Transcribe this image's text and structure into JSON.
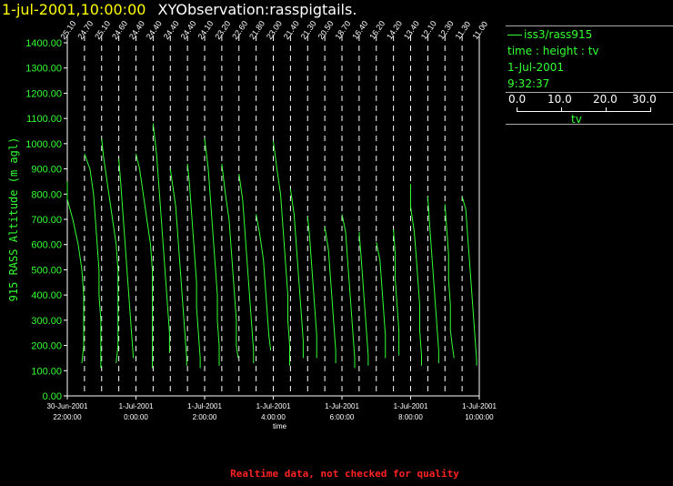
{
  "header": {
    "time_label": "1-jul-2001,10:00:00",
    "observation_label": "XYObservation:rasspigtails."
  },
  "legend": {
    "series_label": "iss3/rass915",
    "axes_desc": "time : height : tv",
    "date": "1-Jul-2001",
    "time": "9:32:37",
    "colorbar_ticks": [
      "0.0",
      "10.0",
      "20.0",
      "30.0"
    ],
    "colorbar_label": "tv"
  },
  "footer": {
    "notice": "Realtime data, not checked for quality"
  },
  "colors": {
    "trace": "#33ff33",
    "axis": "#ffffff",
    "title_time": "#ffff00",
    "notice": "#ff2222"
  },
  "chart_data": {
    "type": "line",
    "ylabel": "915 RASS Altitude (m agl)",
    "xlabel": "time",
    "ylim": [
      0,
      1400
    ],
    "yticks": [
      "0.00",
      "100.00",
      "200.00",
      "300.00",
      "400.00",
      "500.00",
      "600.00",
      "700.00",
      "800.00",
      "900.00",
      "1000.00",
      "1100.00",
      "1200.00",
      "1300.00",
      "1400.00"
    ],
    "xlim": [
      "2001-06-30T22:00",
      "2001-07-01T10:00"
    ],
    "xticks": [
      {
        "t": "2001-06-30T22:00",
        "date": "30-Jun-2001",
        "time": "22:00:00"
      },
      {
        "t": "2001-07-01T00:00",
        "date": "1-Jul-2001",
        "time": "0:00:00"
      },
      {
        "t": "2001-07-01T02:00",
        "date": "1-Jul-2001",
        "time": "2:00:00"
      },
      {
        "t": "2001-07-01T04:00",
        "date": "1-Jul-2001",
        "time": "4:00:00"
      },
      {
        "t": "2001-07-01T06:00",
        "date": "1-Jul-2001",
        "time": "6:00:00"
      },
      {
        "t": "2001-07-01T08:00",
        "date": "1-Jul-2001",
        "time": "8:00:00"
      },
      {
        "t": "2001-07-01T10:00",
        "date": "1-Jul-2001",
        "time": "10:00:00"
      }
    ],
    "profile_times": [
      "2001-06-30T22:00",
      "2001-06-30T22:30",
      "2001-06-30T23:00",
      "2001-06-30T23:30",
      "2001-07-01T00:00",
      "2001-07-01T00:30",
      "2001-07-01T01:00",
      "2001-07-01T01:30",
      "2001-07-01T02:00",
      "2001-07-01T02:30",
      "2001-07-01T03:00",
      "2001-07-01T03:30",
      "2001-07-01T04:00",
      "2001-07-01T04:30",
      "2001-07-01T05:00",
      "2001-07-01T05:30",
      "2001-07-01T06:00",
      "2001-07-01T06:30",
      "2001-07-01T07:00",
      "2001-07-01T07:30",
      "2001-07-01T08:00",
      "2001-07-01T08:30",
      "2001-07-01T09:00",
      "2001-07-01T09:30",
      "2001-07-01T10:00"
    ],
    "profile_labels": [
      "25.10",
      "24.70",
      "25.10",
      "24.60",
      "24.40",
      "24.40",
      "24.40",
      "24.40",
      "24.10",
      "23.20",
      "22.60",
      "21.80",
      "23.00",
      "21.40",
      "21.30",
      "20.50",
      "18.70",
      "16.40",
      "16.20",
      "14.20",
      "13.40",
      "12.10",
      "12.30",
      "11.30",
      "11.00"
    ],
    "series": [
      {
        "profile": 0,
        "points": [
          [
            0.0,
            850
          ],
          [
            0.0,
            780
          ],
          [
            0.3,
            700
          ],
          [
            0.6,
            600
          ],
          [
            0.8,
            500
          ],
          [
            0.9,
            400
          ],
          [
            0.9,
            300
          ],
          [
            0.9,
            200
          ],
          [
            0.8,
            130
          ]
        ]
      },
      {
        "profile": 1,
        "points": [
          [
            0.0,
            960
          ],
          [
            0.3,
            900
          ],
          [
            0.5,
            800
          ],
          [
            0.6,
            700
          ],
          [
            0.7,
            600
          ],
          [
            0.8,
            500
          ],
          [
            0.8,
            400
          ],
          [
            0.9,
            300
          ],
          [
            0.9,
            200
          ],
          [
            0.9,
            110
          ]
        ]
      },
      {
        "profile": 2,
        "points": [
          [
            0.0,
            1020
          ],
          [
            0.1,
            950
          ],
          [
            0.4,
            800
          ],
          [
            0.6,
            700
          ],
          [
            0.8,
            600
          ],
          [
            0.9,
            500
          ],
          [
            0.9,
            400
          ],
          [
            0.9,
            300
          ],
          [
            0.9,
            200
          ],
          [
            0.8,
            130
          ]
        ]
      },
      {
        "profile": 3,
        "points": [
          [
            0.0,
            940
          ],
          [
            0.1,
            850
          ],
          [
            0.2,
            750
          ],
          [
            0.3,
            650
          ],
          [
            0.4,
            550
          ],
          [
            0.5,
            450
          ],
          [
            0.6,
            350
          ],
          [
            0.7,
            250
          ],
          [
            0.8,
            150
          ]
        ]
      },
      {
        "profile": 4,
        "points": [
          [
            0.0,
            960
          ],
          [
            0.2,
            900
          ],
          [
            0.4,
            800
          ],
          [
            0.6,
            700
          ],
          [
            0.8,
            600
          ],
          [
            0.9,
            500
          ],
          [
            0.9,
            400
          ],
          [
            0.9,
            300
          ],
          [
            0.9,
            200
          ],
          [
            0.9,
            110
          ]
        ]
      },
      {
        "profile": 5,
        "points": [
          [
            0.0,
            1080
          ],
          [
            0.2,
            950
          ],
          [
            0.3,
            850
          ],
          [
            0.4,
            750
          ],
          [
            0.5,
            650
          ],
          [
            0.6,
            550
          ],
          [
            0.7,
            450
          ],
          [
            0.8,
            350
          ],
          [
            0.9,
            250
          ],
          [
            0.9,
            170
          ]
        ]
      },
      {
        "profile": 6,
        "points": [
          [
            0.0,
            900
          ],
          [
            0.1,
            850
          ],
          [
            0.3,
            750
          ],
          [
            0.4,
            650
          ],
          [
            0.5,
            550
          ],
          [
            0.6,
            450
          ],
          [
            0.7,
            350
          ],
          [
            0.8,
            250
          ],
          [
            0.9,
            150
          ],
          [
            0.9,
            120
          ]
        ]
      },
      {
        "profile": 7,
        "points": [
          [
            0.0,
            920
          ],
          [
            0.1,
            850
          ],
          [
            0.2,
            750
          ],
          [
            0.3,
            650
          ],
          [
            0.4,
            550
          ],
          [
            0.5,
            450
          ],
          [
            0.5,
            350
          ],
          [
            0.6,
            250
          ],
          [
            0.7,
            150
          ],
          [
            0.7,
            110
          ]
        ]
      },
      {
        "profile": 8,
        "points": [
          [
            0.0,
            1020
          ],
          [
            0.2,
            900
          ],
          [
            0.3,
            800
          ],
          [
            0.4,
            700
          ],
          [
            0.5,
            600
          ],
          [
            0.6,
            500
          ],
          [
            0.7,
            400
          ],
          [
            0.7,
            300
          ],
          [
            0.8,
            200
          ],
          [
            0.8,
            120
          ]
        ]
      },
      {
        "profile": 9,
        "points": [
          [
            0.0,
            920
          ],
          [
            0.2,
            800
          ],
          [
            0.4,
            700
          ],
          [
            0.5,
            600
          ],
          [
            0.6,
            500
          ],
          [
            0.7,
            400
          ],
          [
            0.8,
            300
          ],
          [
            0.8,
            200
          ],
          [
            0.9,
            150
          ]
        ]
      },
      {
        "profile": 10,
        "points": [
          [
            0.0,
            880
          ],
          [
            0.2,
            780
          ],
          [
            0.3,
            680
          ],
          [
            0.4,
            580
          ],
          [
            0.5,
            480
          ],
          [
            0.6,
            380
          ],
          [
            0.7,
            280
          ],
          [
            0.8,
            180
          ],
          [
            0.8,
            130
          ]
        ]
      },
      {
        "profile": 11,
        "points": [
          [
            0.0,
            720
          ],
          [
            0.2,
            640
          ],
          [
            0.4,
            540
          ],
          [
            0.5,
            440
          ],
          [
            0.6,
            340
          ],
          [
            0.7,
            240
          ],
          [
            0.8,
            180
          ]
        ]
      },
      {
        "profile": 12,
        "points": [
          [
            0.0,
            1010
          ],
          [
            0.2,
            900
          ],
          [
            0.4,
            800
          ],
          [
            0.5,
            700
          ],
          [
            0.6,
            600
          ],
          [
            0.7,
            500
          ],
          [
            0.8,
            400
          ],
          [
            0.8,
            300
          ],
          [
            0.9,
            200
          ],
          [
            0.9,
            120
          ]
        ]
      },
      {
        "profile": 13,
        "points": [
          [
            0.0,
            820
          ],
          [
            0.2,
            720
          ],
          [
            0.3,
            620
          ],
          [
            0.4,
            520
          ],
          [
            0.5,
            420
          ],
          [
            0.6,
            320
          ],
          [
            0.7,
            220
          ],
          [
            0.7,
            150
          ]
        ]
      },
      {
        "profile": 14,
        "points": [
          [
            0.0,
            710
          ],
          [
            0.1,
            640
          ],
          [
            0.2,
            540
          ],
          [
            0.3,
            440
          ],
          [
            0.4,
            340
          ],
          [
            0.5,
            240
          ],
          [
            0.5,
            150
          ]
        ]
      },
      {
        "profile": 15,
        "points": [
          [
            0.0,
            670
          ],
          [
            0.2,
            580
          ],
          [
            0.3,
            480
          ],
          [
            0.4,
            380
          ],
          [
            0.5,
            280
          ],
          [
            0.6,
            180
          ],
          [
            0.6,
            130
          ]
        ]
      },
      {
        "profile": 16,
        "points": [
          [
            0.0,
            720
          ],
          [
            0.2,
            650
          ],
          [
            0.3,
            550
          ],
          [
            0.4,
            450
          ],
          [
            0.5,
            350
          ],
          [
            0.6,
            250
          ],
          [
            0.7,
            150
          ],
          [
            0.7,
            110
          ]
        ]
      },
      {
        "profile": 17,
        "points": [
          [
            0.0,
            650
          ],
          [
            0.1,
            560
          ],
          [
            0.2,
            460
          ],
          [
            0.3,
            360
          ],
          [
            0.4,
            260
          ],
          [
            0.5,
            160
          ],
          [
            0.5,
            120
          ]
        ]
      },
      {
        "profile": 18,
        "points": [
          [
            0.0,
            610
          ],
          [
            0.2,
            540
          ],
          [
            0.3,
            440
          ],
          [
            0.4,
            340
          ],
          [
            0.5,
            240
          ],
          [
            0.5,
            150
          ]
        ]
      },
      {
        "profile": 19,
        "points": [
          [
            0.0,
            660
          ],
          [
            0.1,
            560
          ],
          [
            0.1,
            460
          ],
          [
            0.2,
            360
          ],
          [
            0.3,
            260
          ],
          [
            0.3,
            160
          ]
        ]
      },
      {
        "profile": 20,
        "points": [
          [
            0.0,
            840
          ],
          [
            0.0,
            750
          ],
          [
            0.2,
            650
          ],
          [
            0.3,
            560
          ],
          [
            0.4,
            460
          ],
          [
            0.5,
            360
          ],
          [
            0.5,
            260
          ],
          [
            0.6,
            160
          ],
          [
            0.6,
            120
          ]
        ]
      },
      {
        "profile": 21,
        "points": [
          [
            0.0,
            790
          ],
          [
            0.1,
            680
          ],
          [
            0.2,
            580
          ],
          [
            0.3,
            480
          ],
          [
            0.4,
            380
          ],
          [
            0.5,
            280
          ],
          [
            0.6,
            180
          ],
          [
            0.6,
            130
          ]
        ]
      },
      {
        "profile": 22,
        "points": [
          [
            0.0,
            760
          ],
          [
            0.1,
            660
          ],
          [
            0.2,
            560
          ],
          [
            0.2,
            460
          ],
          [
            0.3,
            360
          ],
          [
            0.3,
            260
          ],
          [
            0.4,
            200
          ],
          [
            0.5,
            150
          ]
        ]
      },
      {
        "profile": 23,
        "points": [
          [
            0.0,
            790
          ],
          [
            0.2,
            740
          ],
          [
            0.3,
            640
          ],
          [
            0.4,
            540
          ],
          [
            0.5,
            440
          ],
          [
            0.6,
            340
          ],
          [
            0.7,
            240
          ],
          [
            0.8,
            140
          ],
          [
            0.8,
            120
          ]
        ]
      }
    ]
  }
}
